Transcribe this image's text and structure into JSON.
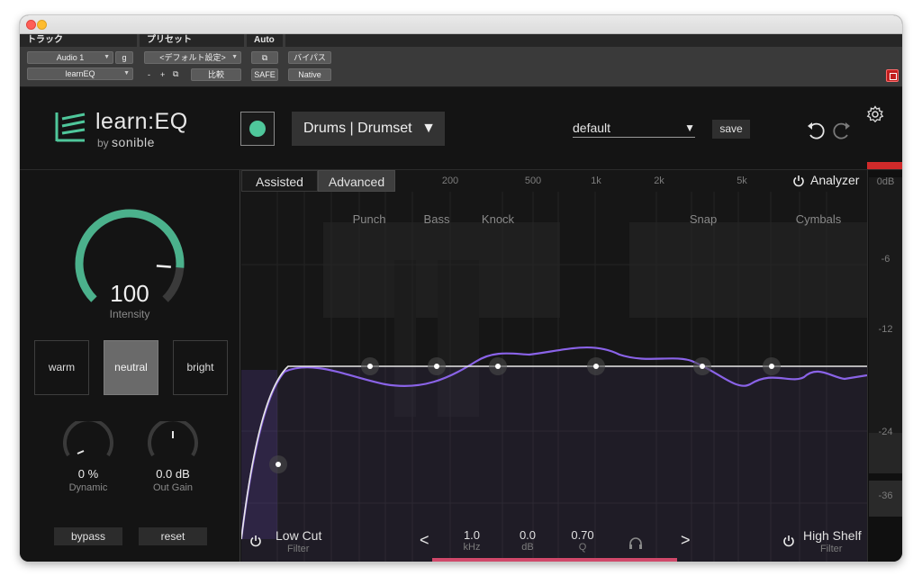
{
  "host": {
    "track_header": "トラック",
    "preset_header": "プリセット",
    "auto_header": "Auto",
    "track_name": "Audio 1",
    "track_group": "g",
    "plugin_name": "learnEQ",
    "preset_name": "<デフォルト設定>",
    "compare": "比較",
    "safe": "SAFE",
    "bypass": "バイパス",
    "native": "Native",
    "minus": "-",
    "plus": "+"
  },
  "header": {
    "logo_title": "learn:EQ",
    "logo_by": "by",
    "logo_brand": "sonible",
    "instrument": "Drums | Drumset",
    "preset": "default",
    "save": "save"
  },
  "left": {
    "intensity_value": "100",
    "intensity_label": "Intensity",
    "intensity_fraction": 0.85,
    "characters": [
      "warm",
      "neutral",
      "bright"
    ],
    "active_character": "neutral",
    "dynamic_value": "0 %",
    "dynamic_label": "Dynamic",
    "outgain_value": "0.0 dB",
    "outgain_label": "Out Gain",
    "bypass": "bypass",
    "reset": "reset"
  },
  "graph": {
    "tabs": [
      "Assisted",
      "Advanced"
    ],
    "active_tab": "Advanced",
    "freq_labels": [
      "200",
      "500",
      "1k",
      "2k",
      "5k"
    ],
    "zones": [
      "Punch",
      "Bass",
      "Knock",
      "Snap",
      "Cymbals"
    ],
    "analyzer": "Analyzer",
    "low_cut": "Low Cut",
    "low_cut_sub": "Filter",
    "high_shelf": "High Shelf",
    "high_shelf_sub": "Filter",
    "freq_value": "1.0",
    "freq_unit": "kHz",
    "gain_value": "0.0",
    "gain_unit": "dB",
    "q_value": "0.70",
    "q_unit": "Q",
    "prev": "<",
    "next": ">"
  },
  "meter": {
    "labels": [
      "0dB",
      "-6",
      "-12",
      "-24",
      "-36"
    ]
  },
  "colors": {
    "accent_green": "#4fc79b",
    "curve_purple": "#8a63e8",
    "meter_peak": "#d02a2a",
    "background": "#141414"
  }
}
